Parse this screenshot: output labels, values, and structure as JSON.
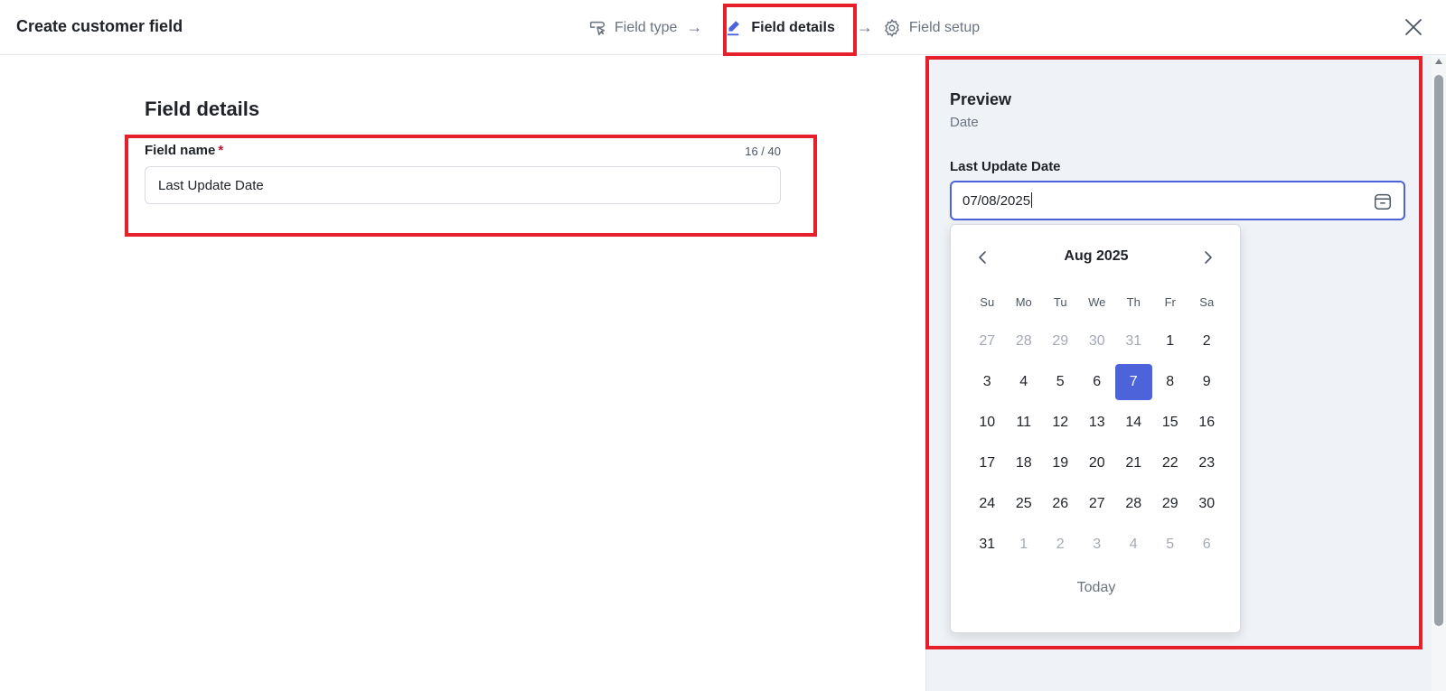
{
  "header": {
    "title": "Create customer field",
    "steps": [
      {
        "label": "Field type",
        "icon": "tag-pointer-icon",
        "state": "done"
      },
      {
        "label": "Field details",
        "icon": "pen-icon",
        "state": "active"
      },
      {
        "label": "Field setup",
        "icon": "gear-icon",
        "state": "pending"
      }
    ],
    "arrow": "→",
    "close_icon": "close-icon"
  },
  "form": {
    "section_title": "Field details",
    "field_name_label": "Field name",
    "required_marker": "*",
    "char_count": "16 / 40",
    "field_name_value": "Last Update Date"
  },
  "preview": {
    "title": "Preview",
    "subtitle": "Date",
    "date_label": "Last Update Date",
    "date_value": "07/08/2025",
    "calendar": {
      "month": "Aug 2025",
      "weekdays": [
        "Su",
        "Mo",
        "Tu",
        "We",
        "Th",
        "Fr",
        "Sa"
      ],
      "days": [
        {
          "d": "27",
          "muted": true
        },
        {
          "d": "28",
          "muted": true
        },
        {
          "d": "29",
          "muted": true
        },
        {
          "d": "30",
          "muted": true
        },
        {
          "d": "31",
          "muted": true
        },
        {
          "d": "1"
        },
        {
          "d": "2"
        },
        {
          "d": "3"
        },
        {
          "d": "4"
        },
        {
          "d": "5"
        },
        {
          "d": "6"
        },
        {
          "d": "7",
          "selected": true
        },
        {
          "d": "8"
        },
        {
          "d": "9"
        },
        {
          "d": "10"
        },
        {
          "d": "11"
        },
        {
          "d": "12"
        },
        {
          "d": "13"
        },
        {
          "d": "14"
        },
        {
          "d": "15"
        },
        {
          "d": "16"
        },
        {
          "d": "17"
        },
        {
          "d": "18"
        },
        {
          "d": "19"
        },
        {
          "d": "20"
        },
        {
          "d": "21"
        },
        {
          "d": "22"
        },
        {
          "d": "23"
        },
        {
          "d": "24"
        },
        {
          "d": "25"
        },
        {
          "d": "26"
        },
        {
          "d": "27"
        },
        {
          "d": "28"
        },
        {
          "d": "29"
        },
        {
          "d": "30"
        },
        {
          "d": "31"
        },
        {
          "d": "1",
          "muted": true
        },
        {
          "d": "2",
          "muted": true
        },
        {
          "d": "3",
          "muted": true
        },
        {
          "d": "4",
          "muted": true
        },
        {
          "d": "5",
          "muted": true
        },
        {
          "d": "6",
          "muted": true
        }
      ],
      "today_label": "Today"
    }
  },
  "colors": {
    "accent": "#4c63d9",
    "highlight": "#e5202b",
    "required": "#c8102e",
    "panel_bg": "#eff2f6"
  }
}
